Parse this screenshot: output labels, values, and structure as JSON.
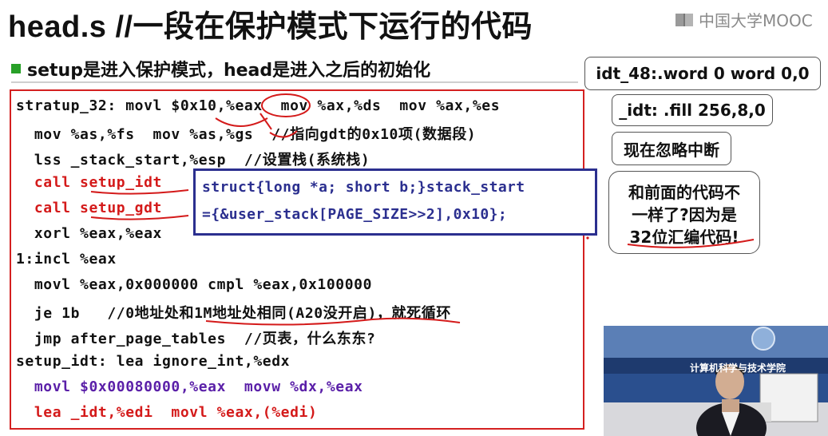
{
  "slide": {
    "title": "head.s //一段在保护模式下运行的代码",
    "logo_text": "中国大学MOOC",
    "bullet": "setup是进入保护模式，head是进入之后的初始化",
    "code_lines": [
      "stratup_32: movl $0x10,%eax  mov %ax,%ds  mov %ax,%es",
      "  mov %as,%fs  mov %as,%gs  //指向gdt的0x10项(数据段)",
      "  lss _stack_start,%esp  //设置栈(系统栈)",
      "  call setup_idt",
      "  call setup_gdt",
      "  xorl %eax,%eax",
      "1:incl %eax",
      "  movl %eax,0x000000 cmpl %eax,0x100000",
      "  je 1b   //0地址处和1M地址处相同(A20没开启)，就死循环",
      "  jmp after_page_tables  //页表，什么东东?",
      "setup_idt: lea ignore_int,%edx",
      "  movl $0x00080000,%eax  movw %dx,%eax",
      "  lea _idt,%edi  movl %eax,(%edi)"
    ],
    "struct_lines": [
      "struct{long *a; short b;}stack_start",
      "={&user_stack[PAGE_SIZE>>2],0x10};"
    ],
    "side_boxes": {
      "idt48": "idt_48:.word 0  word 0,0",
      "idt": "_idt: .fill 256,8,0",
      "ignore": "现在忽略中断"
    },
    "note_lines": [
      "和前面的代码不",
      "一样了?因为是",
      "32位汇编代码!"
    ],
    "video_banner": "计算机科学与技术学院"
  },
  "colors": {
    "code_red": "#d41a1a",
    "code_purple": "#5a1fa8",
    "struct_blue": "#2b2f8f",
    "code_border": "#d42020",
    "bullet_green": "#28a028"
  }
}
